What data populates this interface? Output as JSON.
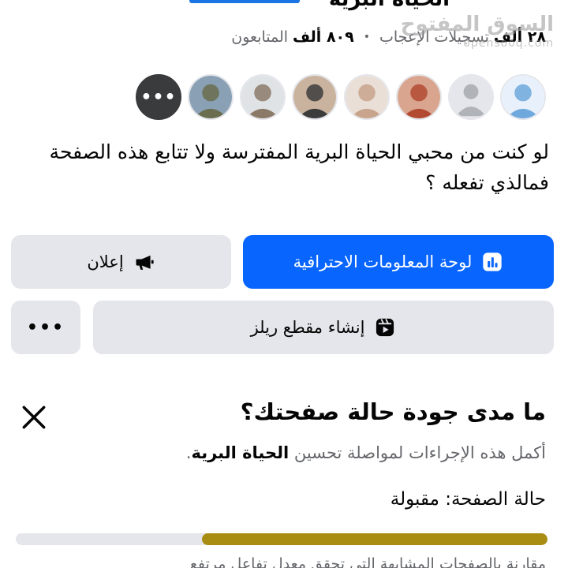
{
  "header": {
    "title_cut": "الحياة البرية"
  },
  "watermark": {
    "brand": "السوق المفتوح",
    "site": "opensooq.com"
  },
  "stats": {
    "likes_count": "٢٨ ألف",
    "likes_label": "تسجيلات الإعجاب",
    "separator": "•",
    "followers_count": "٨٠٩ ألف",
    "followers_label": "المتابعون"
  },
  "followers": {
    "avatars": [
      {
        "name": "avatar-doctors",
        "colors": [
          "#e8f1fb",
          "#6fa8dc"
        ]
      },
      {
        "name": "avatar-default-silhouette",
        "colors": [
          "#e4e6eb",
          "#b0b3b8"
        ]
      },
      {
        "name": "avatar-woman-red-hair",
        "colors": [
          "#d9a58f",
          "#b24a32"
        ]
      },
      {
        "name": "avatar-woman-photo",
        "colors": [
          "#eadfd6",
          "#c8a48c"
        ]
      },
      {
        "name": "avatar-man-with-child",
        "colors": [
          "#c9b39f",
          "#3c3c3c"
        ]
      },
      {
        "name": "avatar-man-with-truck",
        "colors": [
          "#dfe3e6",
          "#8c7a68"
        ]
      },
      {
        "name": "avatar-man-camouflage",
        "colors": [
          "#8aa0b5",
          "#6a6d4e"
        ]
      }
    ],
    "more_label": "•••"
  },
  "bio": {
    "text": "لو كنت من محبي الحياة البرية المفترسة ولا تتابع هذه الصفحة فمالذي تفعله ؟"
  },
  "actions": {
    "dashboard_label": "لوحة المعلومات الاحترافية",
    "ad_label": "إعلان",
    "reels_label": "إنشاء مقطع ريلز",
    "more_label": "•••"
  },
  "quality": {
    "title": "ما مدى جودة حالة صفحتك؟",
    "subtitle_prefix": "أكمل هذه الإجراءات لمواصلة تحسين ",
    "subtitle_bold": "الحياة البرية",
    "subtitle_suffix": ".",
    "status_label": "حالة الصفحة:",
    "status_value": "مقبولة",
    "progress_fraction": 0.65,
    "bottom_text_cut": "مقارنة بالصفحات المشابهة التي تحقق معدل تفاعل مرتفع"
  },
  "colors": {
    "primary": "#0866ff",
    "secondary": "#e4e6eb",
    "progress_fill": "#a98c12",
    "muted_text": "#65676b"
  }
}
